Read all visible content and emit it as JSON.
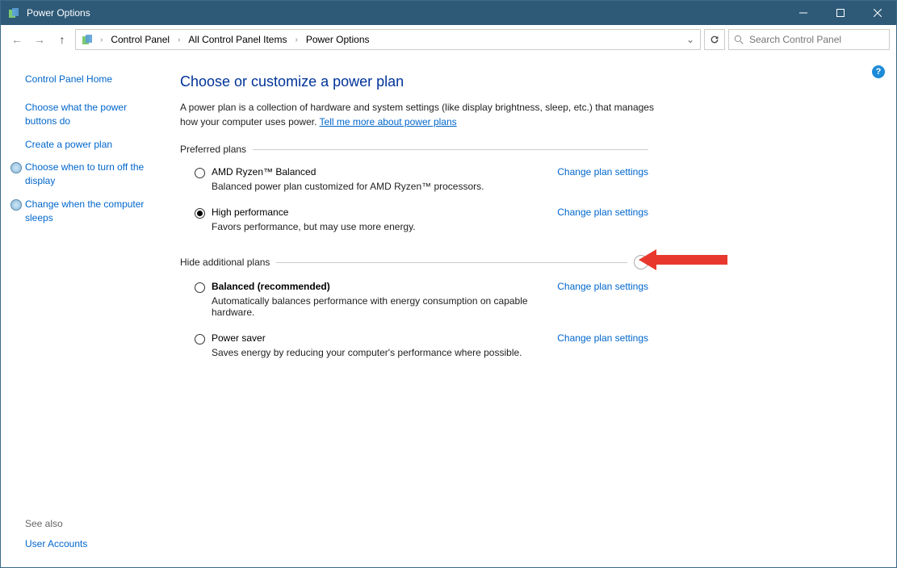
{
  "window": {
    "title": "Power Options"
  },
  "breadcrumb": {
    "items": [
      "Control Panel",
      "All Control Panel Items",
      "Power Options"
    ]
  },
  "search": {
    "placeholder": "Search Control Panel"
  },
  "sidebar": {
    "home": "Control Panel Home",
    "links": [
      "Choose what the power buttons do",
      "Create a power plan",
      "Choose when to turn off the display",
      "Change when the computer sleeps"
    ],
    "see_also_label": "See also",
    "see_also_links": [
      "User Accounts"
    ]
  },
  "main": {
    "heading": "Choose or customize a power plan",
    "desc_text": "A power plan is a collection of hardware and system settings (like display brightness, sleep, etc.) that manages how your computer uses power. ",
    "desc_link": "Tell me more about power plans",
    "preferred_label": "Preferred plans",
    "additional_label": "Hide additional plans",
    "change_label": "Change plan settings",
    "plans_preferred": [
      {
        "name": "AMD Ryzen™ Balanced",
        "desc": "Balanced power plan customized for AMD Ryzen™ processors.",
        "selected": false,
        "bold": false
      },
      {
        "name": "High performance",
        "desc": "Favors performance, but may use more energy.",
        "selected": true,
        "bold": false
      }
    ],
    "plans_additional": [
      {
        "name": "Balanced (recommended)",
        "desc": "Automatically balances performance with energy consumption on capable hardware.",
        "selected": false,
        "bold": true
      },
      {
        "name": "Power saver",
        "desc": "Saves energy by reducing your computer's performance where possible.",
        "selected": false,
        "bold": false
      }
    ]
  }
}
